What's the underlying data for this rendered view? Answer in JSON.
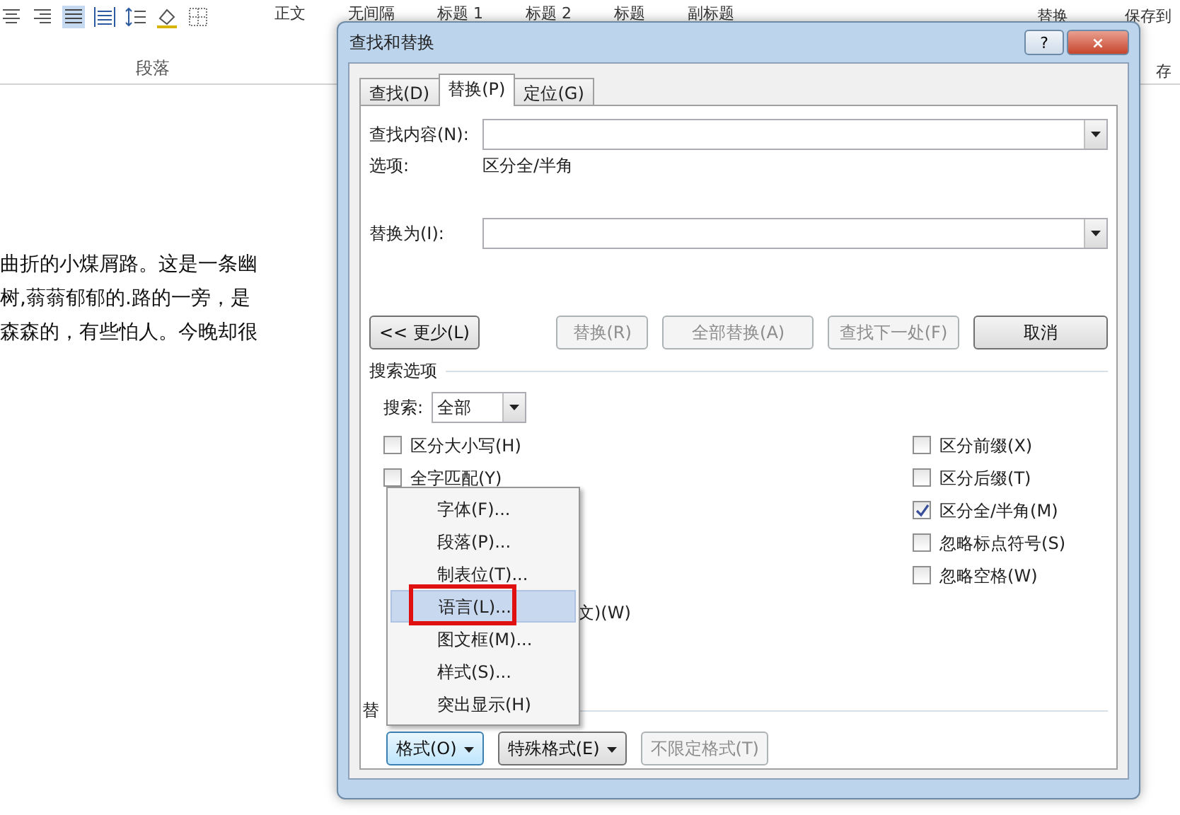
{
  "ribbon": {
    "styles": [
      "正文",
      "无间隔",
      "标题 1",
      "标题 2",
      "标题",
      "副标题"
    ],
    "group_label": "段落",
    "right_items": [
      "替换",
      "保存到",
      "存"
    ]
  },
  "document": {
    "lines": [
      "曲折的小煤屑路。这是一条幽",
      "树,蓊蓊郁郁的.路的一旁，是",
      "森森的，有些怕人。今晚却很"
    ]
  },
  "dialog": {
    "title": "查找和替换",
    "help": "?",
    "close": "×",
    "tabs": [
      {
        "label": "查找(D)",
        "selected": false
      },
      {
        "label": "替换(P)",
        "selected": true
      },
      {
        "label": "定位(G)",
        "selected": false
      }
    ],
    "find_label": "查找内容(N):",
    "options_label": "选项:",
    "options_value": "区分全/半角",
    "replace_label": "替换为(I):",
    "less_button": "<< 更少(L)",
    "buttons": [
      {
        "label": "替换(R)",
        "disabled": true
      },
      {
        "label": "全部替换(A)",
        "disabled": true
      },
      {
        "label": "查找下一处(F)",
        "disabled": true
      },
      {
        "label": "取消",
        "disabled": false
      }
    ],
    "search_options_title": "搜索选项",
    "search_label": "搜索:",
    "search_value": "全部",
    "left_checkboxes": [
      {
        "label": "区分大小写(H)",
        "checked": false
      },
      {
        "label": "全字匹配(Y)",
        "checked": false
      }
    ],
    "hidden_checkbox_tail": "文)(W)",
    "right_checkboxes": [
      {
        "label": "区分前缀(X)",
        "checked": false
      },
      {
        "label": "区分后缀(T)",
        "checked": false
      },
      {
        "label": "区分全/半角(M)",
        "checked": true
      },
      {
        "label": "忽略标点符号(S)",
        "checked": false
      },
      {
        "label": "忽略空格(W)",
        "checked": false
      }
    ],
    "replace_section_label": "替",
    "format_buttons": [
      {
        "label": "格式(O)",
        "dropdown": true,
        "disabled": false,
        "focused": true
      },
      {
        "label": "特殊格式(E)",
        "dropdown": true,
        "disabled": false,
        "focused": false
      },
      {
        "label": "不限定格式(T)",
        "dropdown": false,
        "disabled": true,
        "focused": false
      }
    ],
    "format_menu": [
      {
        "label": "字体(F)...",
        "selected": false
      },
      {
        "label": "段落(P)...",
        "selected": false
      },
      {
        "label": "制表位(T)...",
        "selected": false
      },
      {
        "label": "语言(L)...",
        "selected": true
      },
      {
        "label": "图文框(M)...",
        "selected": false
      },
      {
        "label": "样式(S)...",
        "selected": false
      },
      {
        "label": "突出显示(H)",
        "selected": false
      }
    ]
  }
}
